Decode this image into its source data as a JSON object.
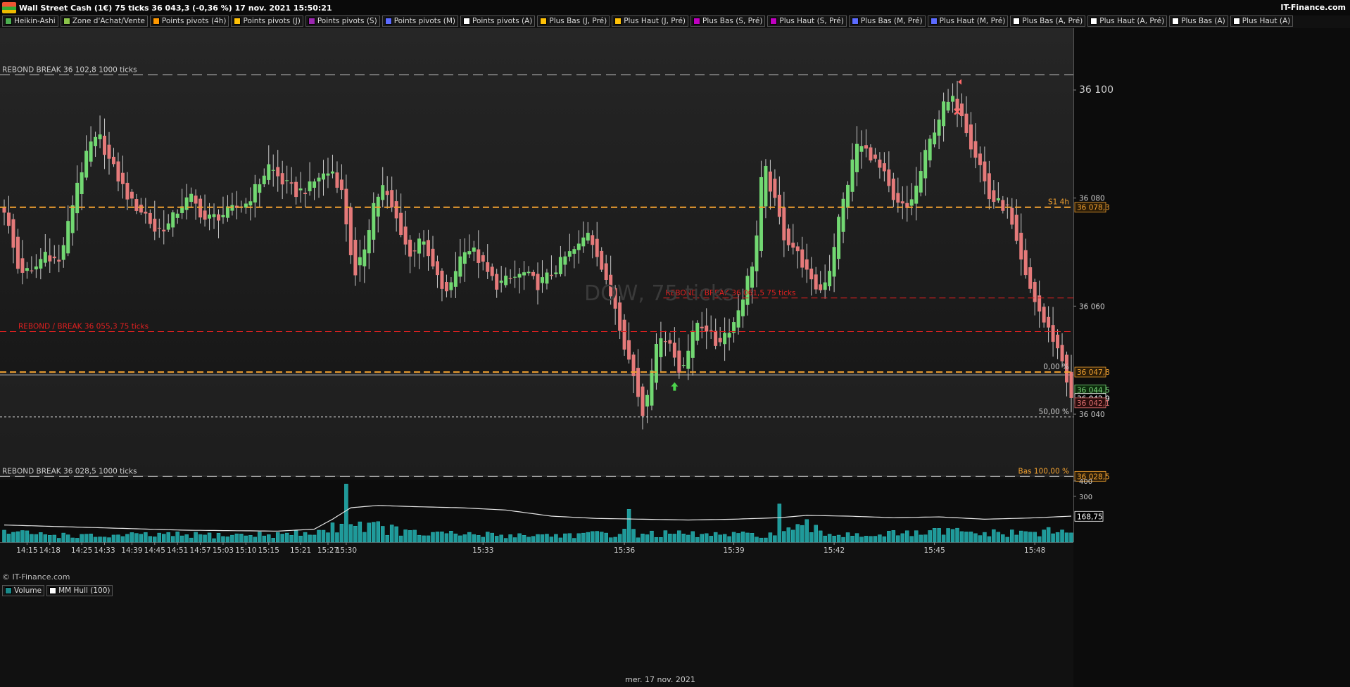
{
  "window": {
    "title": "Wall Street Cash (1€) 75 ticks 36 043,3 (-0,36 %) 17 nov. 2021 15:50:21",
    "brand": "IT-Finance.com",
    "watermark": "DOW, 75 ticks",
    "copyright": "© IT-Finance.com",
    "date": "mer. 17 nov. 2021"
  },
  "indicator_legend": [
    {
      "label": "Heikin-Ashi",
      "color": "#4caf50"
    },
    {
      "label": "Zone d'Achat/Vente",
      "color": "#8bc34a"
    },
    {
      "label": "Points pivots (4h)",
      "color": "#ff9800"
    },
    {
      "label": "Points pivots (J)",
      "color": "#ffc107"
    },
    {
      "label": "Points pivots (S)",
      "color": "#9c27b0"
    },
    {
      "label": "Points pivots (M)",
      "color": "#5c6bff"
    },
    {
      "label": "Points pivots (A)",
      "color": "#ffffff"
    },
    {
      "label": "Plus Bas (J, Pré)",
      "color": "#ffc107"
    },
    {
      "label": "Plus Haut (J, Pré)",
      "color": "#ffc107"
    },
    {
      "label": "Plus Bas (S, Pré)",
      "color": "#c000c0"
    },
    {
      "label": "Plus Haut (S, Pré)",
      "color": "#c000c0"
    },
    {
      "label": "Plus Bas (M, Pré)",
      "color": "#5c6bff"
    },
    {
      "label": "Plus Haut (M, Pré)",
      "color": "#5c6bff"
    },
    {
      "label": "Plus Bas (A, Pré)",
      "color": "#ffffff"
    },
    {
      "label": "Plus Haut (A, Pré)",
      "color": "#ffffff"
    },
    {
      "label": "Plus Bas (A)",
      "color": "#ffffff"
    },
    {
      "label": "Plus Haut (A)",
      "color": "#ffffff"
    }
  ],
  "volume_legend": [
    {
      "label": "Volume",
      "color": "#1a8a8a"
    },
    {
      "label": "MM Hull (100)",
      "color": "#ffffff"
    }
  ],
  "chart_data": {
    "type": "candlestick",
    "ylim": [
      36028,
      36108
    ],
    "volume_ylim": [
      0,
      400
    ],
    "price_ticks": [
      {
        "value": 36100,
        "label": "36 100"
      },
      {
        "value": 36080,
        "label": "36 080"
      },
      {
        "value": 36060,
        "label": "36 060"
      },
      {
        "value": 36040,
        "label": "36 040"
      }
    ],
    "volume_ticks": [
      {
        "value": 400,
        "label": "400"
      },
      {
        "value": 300,
        "label": "300"
      }
    ],
    "x_ticks": [
      {
        "i": 5,
        "label": "14:15"
      },
      {
        "i": 10,
        "label": "14:18"
      },
      {
        "i": 17,
        "label": "14:25"
      },
      {
        "i": 22,
        "label": "14:33"
      },
      {
        "i": 28,
        "label": "14:39"
      },
      {
        "i": 33,
        "label": "14:45"
      },
      {
        "i": 38,
        "label": "14:51"
      },
      {
        "i": 43,
        "label": "14:57"
      },
      {
        "i": 48,
        "label": "15:03"
      },
      {
        "i": 53,
        "label": "15:10"
      },
      {
        "i": 58,
        "label": "15:15"
      },
      {
        "i": 65,
        "label": "15:21"
      },
      {
        "i": 71,
        "label": "15:27"
      },
      {
        "i": 75,
        "label": "15:30"
      },
      {
        "i": 105,
        "label": "15:33"
      },
      {
        "i": 136,
        "label": "15:36"
      },
      {
        "i": 160,
        "label": "15:39"
      },
      {
        "i": 182,
        "label": "15:42"
      },
      {
        "i": 204,
        "label": "15:45"
      },
      {
        "i": 226,
        "label": "15:48"
      }
    ],
    "hlines": [
      {
        "price": 36102.8,
        "color": "#cccccc",
        "dash": "14,7",
        "label": "REBOND BREAK 36 102,8 1000 ticks",
        "label_color": "#cccccc",
        "label_pos": "left"
      },
      {
        "price": 36078.3,
        "color": "#f0a030",
        "dash": "9,5",
        "width": 2,
        "label": "S1 4h",
        "label_color": "#f0a030",
        "label_pos": "right"
      },
      {
        "price": 36061.5,
        "color": "#e02020",
        "dash": "9,5",
        "label": "REBOND / BREAK 36 061,5 75 ticks",
        "label_color": "#e02020",
        "label_pos": "mid",
        "from_i": 145
      },
      {
        "price": 36055.3,
        "color": "#e02020",
        "dash": "9,5",
        "label": "REBOND / BREAK 36 055,3 75 ticks",
        "label_color": "#e02020",
        "label_pos": "leftin"
      },
      {
        "price": 36047.8,
        "color": "#f0a030",
        "dash": "9,5",
        "width": 2,
        "label": "0,00 %",
        "label_color": "#cccccc",
        "label_pos": "right"
      },
      {
        "price": 36039.5,
        "color": "#cccccc",
        "dash": "3,3",
        "label": "50,00 %",
        "label_color": "#cccccc",
        "label_pos": "right"
      },
      {
        "price": 36028.5,
        "color": "#cccccc",
        "dash": "14,7",
        "label": "REBOND BREAK 36 028,5 1000 ticks",
        "label_color": "#cccccc",
        "label_pos": "left"
      }
    ],
    "price_tags": [
      {
        "price": 36078.3,
        "label": "36 078,3",
        "color": "#f0a030",
        "bg": "#2a1c08"
      },
      {
        "price": 36047.8,
        "label": "36 047,8",
        "color": "#f0a030",
        "bg": "#2a1c08"
      },
      {
        "price": 36044.5,
        "label": "36 044,5",
        "color": "#7ddc7d",
        "bg": "#0c2a0c"
      },
      {
        "price": 36042.9,
        "label": "36 042,9",
        "color": "#ffffff",
        "bg": "#000000"
      },
      {
        "price": 36042.1,
        "label": "36 042,1",
        "color": "#e07070",
        "bg": "#2a0c0c"
      },
      {
        "price": 36028.5,
        "label": "36 028,5",
        "color": "#f0a030",
        "bg": "#2a1c08"
      }
    ],
    "volume_tag": {
      "value": 168.75,
      "label": "168,75"
    },
    "bottom_right_label": "Bas 100,00 %",
    "markers": [
      {
        "type": "arrow-up",
        "i": 147,
        "price": 36045,
        "color": "#4cd44c"
      },
      {
        "type": "cross",
        "i": 209,
        "price": 36096,
        "color": "#ff6a6a"
      },
      {
        "type": "flag",
        "i": 209,
        "price": 36101.5,
        "color": "#ff6a6a"
      }
    ],
    "waypoints": [
      [
        0,
        36078
      ],
      [
        3,
        36067
      ],
      [
        6,
        36066
      ],
      [
        9,
        36070
      ],
      [
        12,
        36068
      ],
      [
        14,
        36075
      ],
      [
        16,
        36083
      ],
      [
        19,
        36090
      ],
      [
        21,
        36091
      ],
      [
        23,
        36087
      ],
      [
        26,
        36082
      ],
      [
        28,
        36079
      ],
      [
        31,
        36077
      ],
      [
        33,
        36074
      ],
      [
        36,
        36075
      ],
      [
        39,
        36079
      ],
      [
        41,
        36080
      ],
      [
        44,
        36076
      ],
      [
        48,
        36077
      ],
      [
        53,
        36079
      ],
      [
        56,
        36083
      ],
      [
        58,
        36086
      ],
      [
        61,
        36083
      ],
      [
        64,
        36081
      ],
      [
        67,
        36082
      ],
      [
        69,
        36084
      ],
      [
        72,
        36085
      ],
      [
        74,
        36081
      ],
      [
        76,
        36070
      ],
      [
        77,
        36065
      ],
      [
        79,
        36071
      ],
      [
        81,
        36079
      ],
      [
        83,
        36082
      ],
      [
        85,
        36078
      ],
      [
        87,
        36074
      ],
      [
        89,
        36069
      ],
      [
        91,
        36073
      ],
      [
        93,
        36069
      ],
      [
        95,
        36065
      ],
      [
        97,
        36062
      ],
      [
        99,
        36067
      ],
      [
        101,
        36071
      ],
      [
        103,
        36070
      ],
      [
        106,
        36066
      ],
      [
        108,
        36064
      ],
      [
        111,
        36065
      ],
      [
        114,
        36066
      ],
      [
        117,
        36064
      ],
      [
        120,
        36066
      ],
      [
        123,
        36069
      ],
      [
        126,
        36071
      ],
      [
        128,
        36074
      ],
      [
        130,
        36070
      ],
      [
        132,
        36064
      ],
      [
        134,
        36060
      ],
      [
        136,
        36053
      ],
      [
        138,
        36047
      ],
      [
        140,
        36040
      ],
      [
        142,
        36049
      ],
      [
        144,
        36055
      ],
      [
        146,
        36053
      ],
      [
        148,
        36048
      ],
      [
        150,
        36052
      ],
      [
        152,
        36057
      ],
      [
        154,
        36056
      ],
      [
        156,
        36053
      ],
      [
        158,
        36055
      ],
      [
        160,
        36057
      ],
      [
        162,
        36062
      ],
      [
        164,
        36068
      ],
      [
        165,
        36073
      ],
      [
        166,
        36083
      ],
      [
        167,
        36085
      ],
      [
        169,
        36079
      ],
      [
        171,
        36073
      ],
      [
        173,
        36071
      ],
      [
        175,
        36068
      ],
      [
        177,
        36064
      ],
      [
        179,
        36063
      ],
      [
        181,
        36067
      ],
      [
        183,
        36076
      ],
      [
        185,
        36083
      ],
      [
        187,
        36090
      ],
      [
        190,
        36088
      ],
      [
        193,
        36084
      ],
      [
        195,
        36079
      ],
      [
        198,
        36078
      ],
      [
        200,
        36082
      ],
      [
        202,
        36088
      ],
      [
        204,
        36093
      ],
      [
        206,
        36097
      ],
      [
        208,
        36098
      ],
      [
        210,
        36096
      ],
      [
        212,
        36090
      ],
      [
        214,
        36086
      ],
      [
        216,
        36080
      ],
      [
        218,
        36079
      ],
      [
        220,
        36078
      ],
      [
        222,
        36071
      ],
      [
        224,
        36065
      ],
      [
        226,
        36061
      ],
      [
        228,
        36057
      ],
      [
        230,
        36054
      ],
      [
        232,
        36050
      ],
      [
        234,
        36043
      ]
    ],
    "volume_profile": [
      [
        0,
        75
      ],
      [
        5,
        60
      ],
      [
        10,
        55
      ],
      [
        20,
        40
      ],
      [
        30,
        50
      ],
      [
        40,
        50
      ],
      [
        50,
        50
      ],
      [
        60,
        55
      ],
      [
        66,
        60
      ],
      [
        70,
        80
      ],
      [
        74,
        120
      ],
      [
        75,
        230
      ],
      [
        76,
        140
      ],
      [
        80,
        120
      ],
      [
        90,
        60
      ],
      [
        100,
        55
      ],
      [
        110,
        50
      ],
      [
        120,
        50
      ],
      [
        130,
        55
      ],
      [
        136,
        70
      ],
      [
        140,
        60
      ],
      [
        150,
        55
      ],
      [
        160,
        50
      ],
      [
        170,
        55
      ],
      [
        176,
        110
      ],
      [
        180,
        60
      ],
      [
        190,
        55
      ],
      [
        200,
        60
      ],
      [
        208,
        80
      ],
      [
        210,
        65
      ],
      [
        220,
        60
      ],
      [
        226,
        70
      ],
      [
        234,
        75
      ]
    ],
    "hull_profile": [
      [
        0,
        112
      ],
      [
        20,
        95
      ],
      [
        40,
        78
      ],
      [
        60,
        72
      ],
      [
        68,
        85
      ],
      [
        72,
        150
      ],
      [
        76,
        225
      ],
      [
        82,
        240
      ],
      [
        90,
        232
      ],
      [
        100,
        225
      ],
      [
        110,
        210
      ],
      [
        120,
        170
      ],
      [
        130,
        155
      ],
      [
        140,
        150
      ],
      [
        150,
        145
      ],
      [
        160,
        150
      ],
      [
        170,
        160
      ],
      [
        176,
        175
      ],
      [
        185,
        170
      ],
      [
        195,
        160
      ],
      [
        205,
        165
      ],
      [
        215,
        150
      ],
      [
        225,
        158
      ],
      [
        234,
        170
      ]
    ]
  }
}
